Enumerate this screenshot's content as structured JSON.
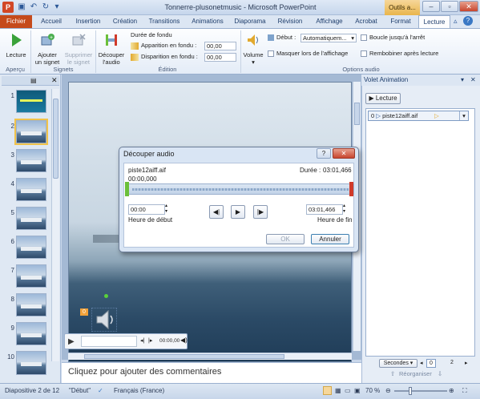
{
  "window": {
    "title": "Tonnerre-plusonetmusic - Microsoft PowerPoint",
    "contextual": "Outils a..."
  },
  "tabs": [
    "Fichier",
    "Accueil",
    "Insertion",
    "Création",
    "Transitions",
    "Animations",
    "Diaporama",
    "Révision",
    "Affichage",
    "Acrobat",
    "Format",
    "Lecture"
  ],
  "ribbon": {
    "groups": {
      "apercu": "Aperçu",
      "signets": "Signets",
      "edition": "Édition",
      "options": "Options audio"
    },
    "lecture_label": "Lecture",
    "add_bookmark": [
      "Ajouter",
      "un signet"
    ],
    "remove_bookmark": [
      "Supprimer",
      "le signet"
    ],
    "trim_audio": [
      "Découper",
      "l'audio"
    ],
    "fade_duration": "Durée de fondu",
    "fade_in": "Apparition en fondu :",
    "fade_in_value": "00,00",
    "fade_out": "Disparition en fondu :",
    "fade_out_value": "00,00",
    "volume": "Volume",
    "start_label": "Début :",
    "start_value": "Automatiquem...",
    "hide_during_show": "Masquer lors de l'affichage",
    "loop": "Boucle jusqu'à l'arrêt",
    "rewind": "Rembobiner après lecture"
  },
  "slides": [
    "1",
    "2",
    "3",
    "4",
    "5",
    "6",
    "7",
    "8",
    "9",
    "10"
  ],
  "player": {
    "time": "00:00,00"
  },
  "notes_placeholder": "Cliquez pour ajouter des commentaires",
  "pane": {
    "title": "Volet Animation",
    "play_button": "Lecture",
    "item_index": "0",
    "item_name": "piste12aiff.aif",
    "seconds": "Secondes",
    "timeline_0": "0",
    "timeline_2": "2",
    "reorder": "Réorganiser"
  },
  "dialog": {
    "title": "Découper audio",
    "file": "piste12aiff.aif",
    "duration_label": "Durée :",
    "duration_value": "03:01,466",
    "position": "00:00,000",
    "start_value": "00:00",
    "start_label": "Heure de début",
    "end_value": "03:01,466",
    "end_label": "Heure de fin",
    "ok": "OK",
    "cancel": "Annuler"
  },
  "status": {
    "slide": "Diapositive 2 de 12",
    "theme": "\"Début\"",
    "language": "Français (France)",
    "zoom": "70 %"
  },
  "colors": {
    "file_tab": "#c54a1b",
    "accent": "#2b5797",
    "trim_start": "#6bbf3a",
    "trim_end": "#d03a2a"
  }
}
